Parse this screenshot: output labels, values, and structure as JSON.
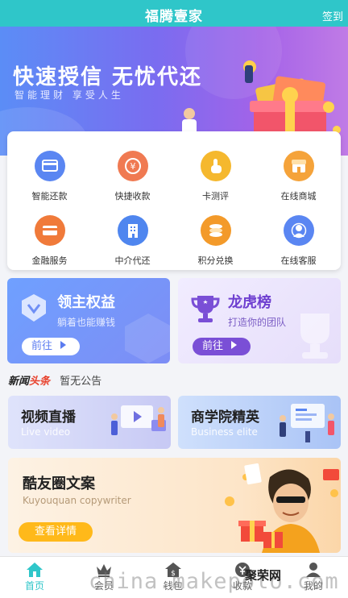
{
  "header": {
    "title": "福腾壹家",
    "signin_label": "签到"
  },
  "banner": {
    "title": "快速授信 无忧代还",
    "subtitle": "智能理财 享受人生"
  },
  "services": [
    {
      "label": "智能还款",
      "icon": "card-return-icon",
      "color": "#5a86f2"
    },
    {
      "label": "快捷收款",
      "icon": "yuan-coin-icon",
      "color": "#f07a52"
    },
    {
      "label": "卡测评",
      "icon": "hand-pointer-icon",
      "color": "#f5b82e"
    },
    {
      "label": "在线商城",
      "icon": "store-icon",
      "color": "#f5a33a"
    },
    {
      "label": "金融服务",
      "icon": "credit-card-icon",
      "color": "#f07a3a"
    },
    {
      "label": "中介代还",
      "icon": "building-icon",
      "color": "#4f86ef"
    },
    {
      "label": "积分兑换",
      "icon": "coins-stack-icon",
      "color": "#f39a2a"
    },
    {
      "label": "在线客服",
      "icon": "user-support-icon",
      "color": "#5a86f2"
    }
  ],
  "promos": {
    "left": {
      "title": "领主权益",
      "subtitle": "躺着也能赚钱",
      "button": "前往"
    },
    "right": {
      "title": "龙虎榜",
      "subtitle": "打造你的团队",
      "button": "前往"
    }
  },
  "notice": {
    "tag_part1": "新闻",
    "tag_part2": "头条",
    "text": "暂无公告"
  },
  "features": {
    "left": {
      "title": "视频直播",
      "subtitle": "Live video"
    },
    "right": {
      "title": "商学院精英",
      "subtitle": "Business elite"
    }
  },
  "bigcard": {
    "title": "酷友圈文案",
    "subtitle": "Kuyouquan copywriter",
    "button": "查看详情"
  },
  "tabs": [
    {
      "label": "首页",
      "icon": "home-icon",
      "active": true
    },
    {
      "label": "会员",
      "icon": "crown-icon",
      "active": false
    },
    {
      "label": "钱包",
      "icon": "wallet-house-icon",
      "active": false
    },
    {
      "label": "收款",
      "icon": "collect-icon",
      "active": false
    },
    {
      "label": "我的",
      "icon": "person-icon",
      "active": false
    }
  ],
  "watermark": {
    "text": "china.makepolo.com",
    "logo": "聚荣网"
  },
  "colors": {
    "primary": "#2fc6c9",
    "accent_purple": "#7a5cf0",
    "accent_gold": "#ffb91a"
  }
}
